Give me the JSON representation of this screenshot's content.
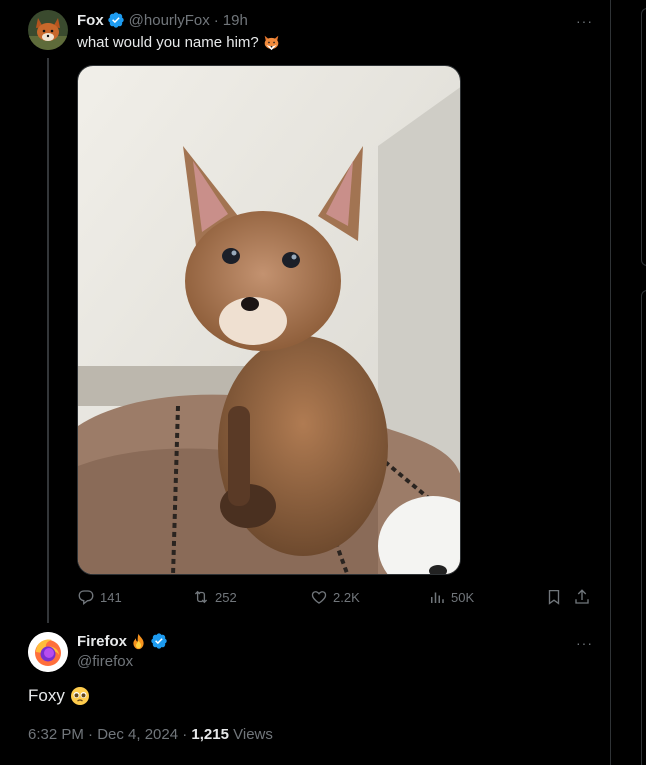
{
  "tweet": {
    "author_name": "Fox",
    "handle": "@hourlyFox",
    "separator": "·",
    "time": "19h",
    "text": "what would you name him?",
    "emoji": "fox-face-emoji",
    "image": "fox-kit-photo",
    "stats": {
      "replies": "141",
      "retweets": "252",
      "likes": "2.2K",
      "views": "50K"
    }
  },
  "reply": {
    "author_name": "Firefox",
    "handle": "@firefox",
    "text": "Foxy",
    "emoji": "pleading-face-emoji",
    "date": "6:32 PM · Dec 4, 2024 · ",
    "view_count": "1,215",
    "views_label": " Views"
  },
  "colors": {
    "background": "#000000",
    "text": "#e7e9ea",
    "muted": "#71767b",
    "border": "#2f3336",
    "verified": "#1d9bf0"
  }
}
